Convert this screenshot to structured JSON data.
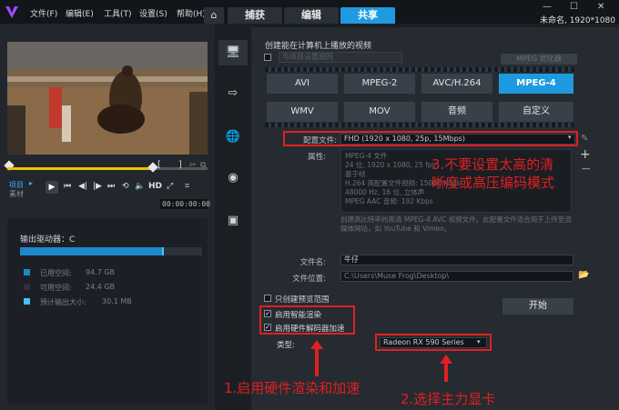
{
  "menu": {
    "file": "文件(F)",
    "edit": "编辑(E)",
    "tools": "工具(T)",
    "settings": "设置(S)",
    "help": "帮助(H)"
  },
  "tabs": {
    "capture": "捕获",
    "edit": "编辑",
    "share": "共享"
  },
  "project": {
    "name": "未命名, 1920*1080"
  },
  "player": {
    "project_label": "项目",
    "clip_label": "素材",
    "hd": "HD",
    "timecode": "00:00:00:00"
  },
  "output": {
    "drive_label": "输出驱动器：C",
    "usage_fill": 0.78,
    "used_label": "已用空间:",
    "used_value": "94.7 GB",
    "free_label": "可用空间:",
    "free_value": "24.4 GB",
    "est_label": "预计输出大小:",
    "est_value": "30.1 MB"
  },
  "share": {
    "heading": "创建能在计算机上播放的视频",
    "same_as_project": "与项目设置相同",
    "mpeg_opt": "MPEG 优化器",
    "formats_row1": [
      "AVI",
      "MPEG-2",
      "AVC/H.264",
      "MPEG-4"
    ],
    "formats_row2": [
      "WMV",
      "MOV",
      "音频",
      "自定义"
    ],
    "profile_label": "配置文件:",
    "profile_value": "FHD (1920 x 1080, 25p, 15Mbps)",
    "props_label": "属性:",
    "props_lines": [
      "MPEG-4 文件",
      "24 位, 1920 x 1080, 25 fps",
      "基于帧",
      "H.264 高配置文件视频: 15000 Kbps",
      "48000 Hz, 16 位, 立体声",
      "MPEG AAC 音频: 192 Kbps"
    ],
    "description": "创建高比特率的高清 MPEG-4 AVC 视频文件。此配置文件适合用于上传至流媒体网站，如 YouTube 和 Vimeo。",
    "filename_label": "文件名:",
    "filename_value": "牛仔",
    "location_label": "文件位置:",
    "location_value": "C:\\Users\\Muse Frog\\Desktop\\",
    "preview_only": "只创建预览范围",
    "smart_render": "启用智能渲染",
    "hw_decode": "启用硬件解码器加速",
    "type_label": "类型:",
    "gpu_value": "Radeon RX 590 Series",
    "start": "开始"
  },
  "annotations": {
    "note1": "1.启用硬件渲染和加速",
    "note2": "2.选择主力显卡",
    "note3_line1": "3.不要设置太高的清",
    "note3_line2": "晰度或高压编码模式"
  },
  "colors": {
    "accent": "#1e9be0",
    "annotation": "#e02020",
    "timeline": "#f0c000"
  }
}
